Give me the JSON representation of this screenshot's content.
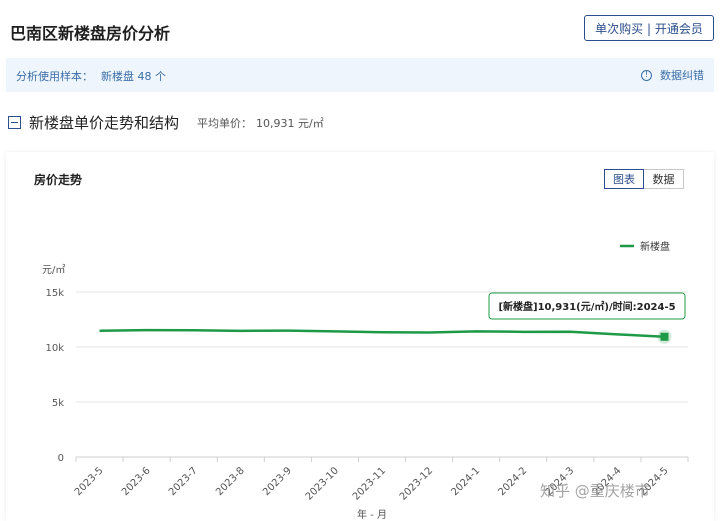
{
  "header": {
    "title": "巴南区新楼盘房价分析",
    "buy_button": "单次购买 | 开通会员"
  },
  "sample": {
    "label": "分析使用样本：",
    "value": "新楼盘 48 个",
    "correction": "数据纠错",
    "correction_icon": "info-icon"
  },
  "section": {
    "title": "新楼盘单价走势和结构",
    "avg_label": "平均单价：",
    "avg_value": "10,931 元/㎡",
    "collapse_icon": "minus-square-icon"
  },
  "chart_panel": {
    "title": "房价走势",
    "tabs": [
      "图表",
      "数据"
    ],
    "active_tab": "图表"
  },
  "watermark": "知乎 @重庆楼市",
  "chart_data": {
    "type": "line",
    "ylabel": "元/㎡",
    "xlabel": "年 - 月",
    "ylim": [
      0,
      15000
    ],
    "y_ticks": [
      "0",
      "5k",
      "10k",
      "15k"
    ],
    "grid": true,
    "legend_position": "top-right",
    "x": [
      "2023-5",
      "2023-6",
      "2023-7",
      "2023-8",
      "2023-9",
      "2023-10",
      "2023-11",
      "2023-12",
      "2024-1",
      "2024-2",
      "2024-3",
      "2024-4",
      "2024-5"
    ],
    "series": [
      {
        "name": "新楼盘",
        "color": "#1e9a46",
        "values": [
          11480,
          11530,
          11520,
          11470,
          11490,
          11420,
          11340,
          11320,
          11420,
          11380,
          11390,
          11150,
          10931
        ]
      }
    ],
    "tooltip": "[新楼盘]10,931(元/㎡)/时间:2024-5"
  }
}
